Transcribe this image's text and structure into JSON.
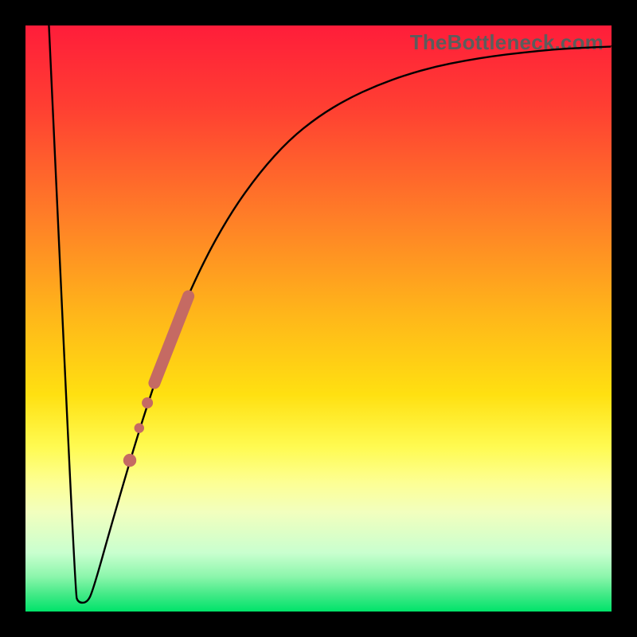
{
  "watermark": "TheBottleneck.com",
  "colors": {
    "frame": "#000000",
    "curve": "#000000",
    "marker_fill": "#c56a63",
    "marker_stroke": "#c56a63"
  },
  "chart_data": {
    "type": "line",
    "title": "",
    "xlabel": "",
    "ylabel": "",
    "xlim": [
      0,
      100
    ],
    "ylim": [
      0,
      100
    ],
    "grid": false,
    "legend": false,
    "curve": [
      {
        "x": 4.0,
        "y": 100.0
      },
      {
        "x": 8.5,
        "y": 3.0
      },
      {
        "x": 9.0,
        "y": 1.5
      },
      {
        "x": 10.5,
        "y": 1.5
      },
      {
        "x": 11.5,
        "y": 3.5
      },
      {
        "x": 15.0,
        "y": 16.0
      },
      {
        "x": 20.0,
        "y": 33.0
      },
      {
        "x": 25.0,
        "y": 47.5
      },
      {
        "x": 30.0,
        "y": 59.0
      },
      {
        "x": 35.0,
        "y": 68.0
      },
      {
        "x": 40.0,
        "y": 75.0
      },
      {
        "x": 45.0,
        "y": 80.5
      },
      {
        "x": 50.0,
        "y": 84.5
      },
      {
        "x": 55.0,
        "y": 87.5
      },
      {
        "x": 60.0,
        "y": 89.8
      },
      {
        "x": 65.0,
        "y": 91.6
      },
      {
        "x": 70.0,
        "y": 93.0
      },
      {
        "x": 75.0,
        "y": 94.0
      },
      {
        "x": 80.0,
        "y": 94.8
      },
      {
        "x": 85.0,
        "y": 95.4
      },
      {
        "x": 90.0,
        "y": 95.9
      },
      {
        "x": 95.0,
        "y": 96.2
      },
      {
        "x": 100.0,
        "y": 96.4
      }
    ],
    "highlight_segment": {
      "x_start": 22.0,
      "y_start": 39.0,
      "x_end": 27.8,
      "y_end": 53.8
    },
    "highlight_points": [
      {
        "x": 20.8,
        "y": 35.6
      },
      {
        "x": 19.4,
        "y": 31.3
      },
      {
        "x": 17.8,
        "y": 25.8
      }
    ]
  }
}
